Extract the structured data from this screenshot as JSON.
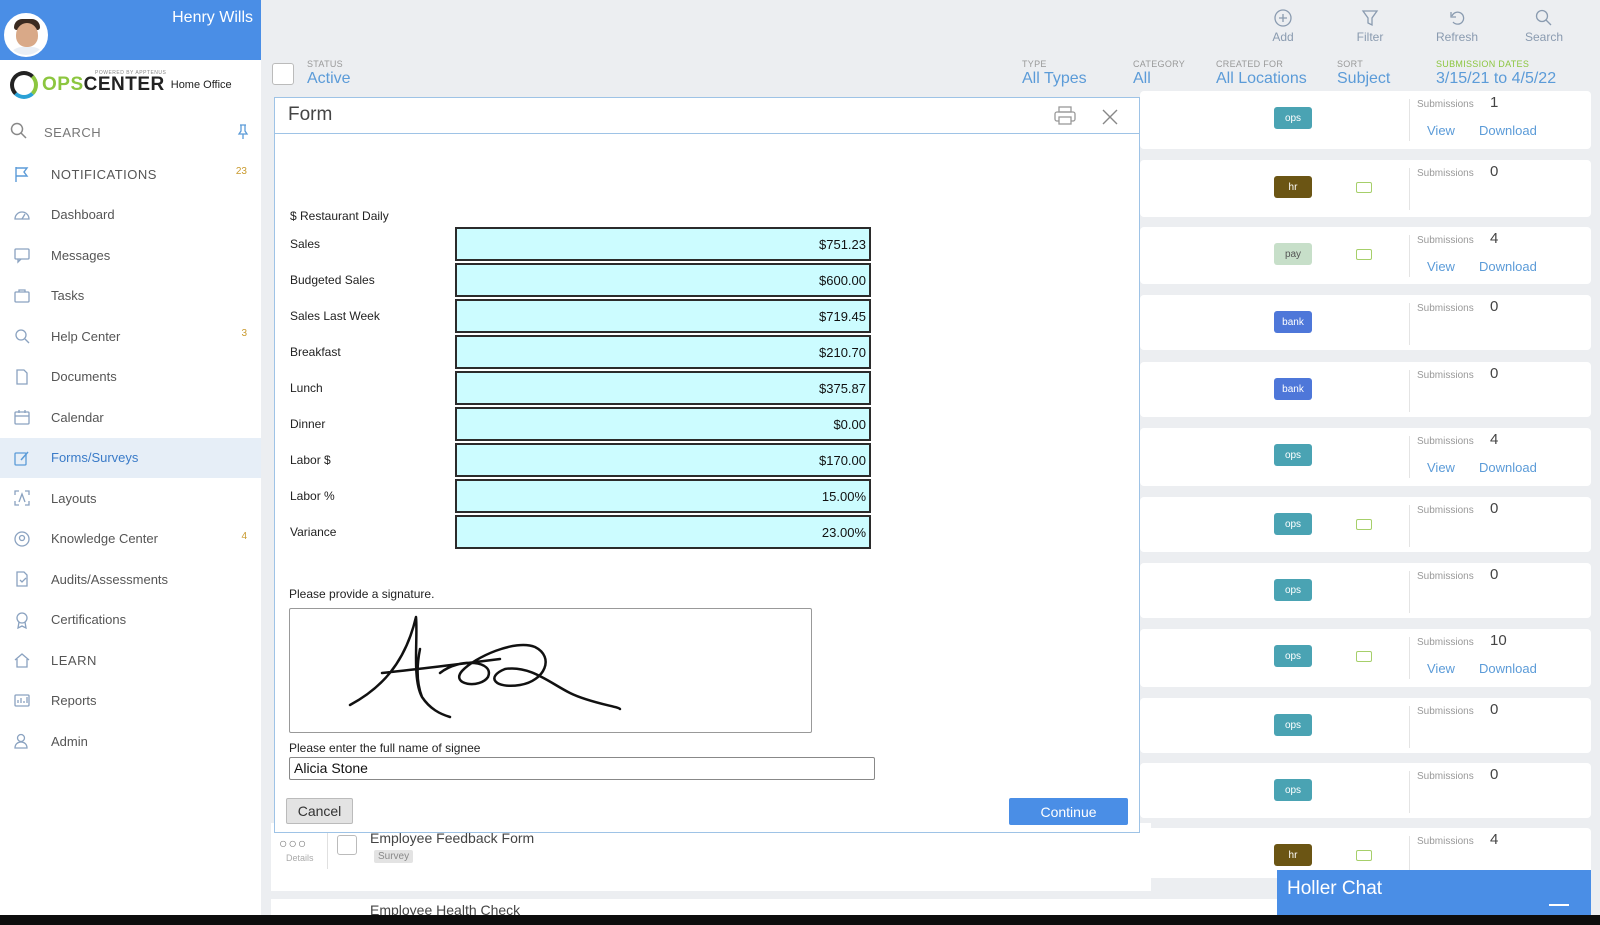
{
  "user": {
    "name": "Henry Wills"
  },
  "brand": {
    "ops": "OPS",
    "center": "CENTER",
    "office": "Home Office",
    "powered": "POWERED BY APPTENUS"
  },
  "sidebar": {
    "search_label": "SEARCH",
    "items": [
      {
        "label": "NOTIFICATIONS",
        "badge": "23",
        "icon": "flag-icon"
      },
      {
        "label": "Dashboard",
        "badge": "",
        "icon": "dashboard-icon"
      },
      {
        "label": "Messages",
        "badge": "",
        "icon": "messages-icon"
      },
      {
        "label": "Tasks",
        "badge": "",
        "icon": "tasks-icon"
      },
      {
        "label": "Help Center",
        "badge": "3",
        "icon": "help-center-icon"
      },
      {
        "label": "Documents",
        "badge": "",
        "icon": "documents-icon"
      },
      {
        "label": "Calendar",
        "badge": "",
        "icon": "calendar-icon"
      },
      {
        "label": "Forms/Surveys",
        "badge": "",
        "icon": "forms-icon",
        "active": true
      },
      {
        "label": "Layouts",
        "badge": "",
        "icon": "layouts-icon"
      },
      {
        "label": "Knowledge Center",
        "badge": "4",
        "icon": "knowledge-icon"
      },
      {
        "label": "Audits/Assessments",
        "badge": "",
        "icon": "audits-icon"
      },
      {
        "label": "Certifications",
        "badge": "",
        "icon": "certifications-icon"
      },
      {
        "label": "LEARN",
        "badge": "",
        "icon": "learn-icon"
      },
      {
        "label": "Reports",
        "badge": "",
        "icon": "reports-icon"
      },
      {
        "label": "Admin",
        "badge": "",
        "icon": "admin-icon"
      }
    ]
  },
  "toolbar": {
    "add": "Add",
    "filter": "Filter",
    "refresh": "Refresh",
    "search": "Search"
  },
  "filters": {
    "status": {
      "label": "STATUS",
      "value": "Active"
    },
    "type": {
      "label": "TYPE",
      "value": "All Types"
    },
    "category": {
      "label": "CATEGORY",
      "value": "All"
    },
    "created_for": {
      "label": "CREATED FOR",
      "value": "All Locations"
    },
    "sort": {
      "label": "SORT",
      "value": "Subject"
    },
    "submission_dates": {
      "label": "SUBMISSION DATES",
      "value": "3/15/21 to 4/5/22"
    }
  },
  "cards": [
    {
      "tag": "ops",
      "chat": false,
      "count": "1",
      "links": true
    },
    {
      "tag": "hr",
      "chat": true,
      "count": "0",
      "links": false
    },
    {
      "tag": "pay",
      "chat": true,
      "count": "4",
      "links": true
    },
    {
      "tag": "bank",
      "chat": false,
      "count": "0",
      "links": false
    },
    {
      "tag": "bank",
      "chat": false,
      "count": "0",
      "links": false
    },
    {
      "tag": "ops",
      "chat": false,
      "count": "4",
      "links": true
    },
    {
      "tag": "ops",
      "chat": true,
      "count": "0",
      "links": false
    },
    {
      "tag": "ops",
      "chat": false,
      "count": "0",
      "links": false
    },
    {
      "tag": "ops",
      "chat": true,
      "count": "10",
      "links": true
    },
    {
      "tag": "ops",
      "chat": false,
      "count": "0",
      "links": false
    },
    {
      "tag": "ops",
      "chat": false,
      "count": "0",
      "links": false
    },
    {
      "tag": "hr",
      "chat": true,
      "count": "4",
      "links": false
    }
  ],
  "card_text": {
    "submissions": "Submissions",
    "view": "View",
    "download": "Download"
  },
  "list": {
    "row1": {
      "dots": "○○○",
      "details": "Details",
      "title": "Employee Feedback Form",
      "type": "Survey"
    },
    "row2": {
      "title": "Employee Health Check"
    }
  },
  "modal": {
    "title": "Form",
    "section": "$ Restaurant Daily",
    "fields": [
      {
        "label": "Sales",
        "value": "$751.23"
      },
      {
        "label": "Budgeted Sales",
        "value": "$600.00"
      },
      {
        "label": "Sales Last Week",
        "value": "$719.45"
      },
      {
        "label": "Breakfast",
        "value": "$210.70"
      },
      {
        "label": "Lunch",
        "value": "$375.87"
      },
      {
        "label": "Dinner",
        "value": "$0.00"
      },
      {
        "label": "Labor $",
        "value": "$170.00"
      },
      {
        "label": "Labor %",
        "value": "15.00%"
      },
      {
        "label": "Variance",
        "value": "23.00%"
      }
    ],
    "signature_prompt": "Please provide a signature.",
    "name_prompt": "Please enter the full name of signee",
    "name_value": "Alicia Stone",
    "cancel": "Cancel",
    "continue": "Continue"
  },
  "holler": {
    "title": "Holler Chat"
  }
}
